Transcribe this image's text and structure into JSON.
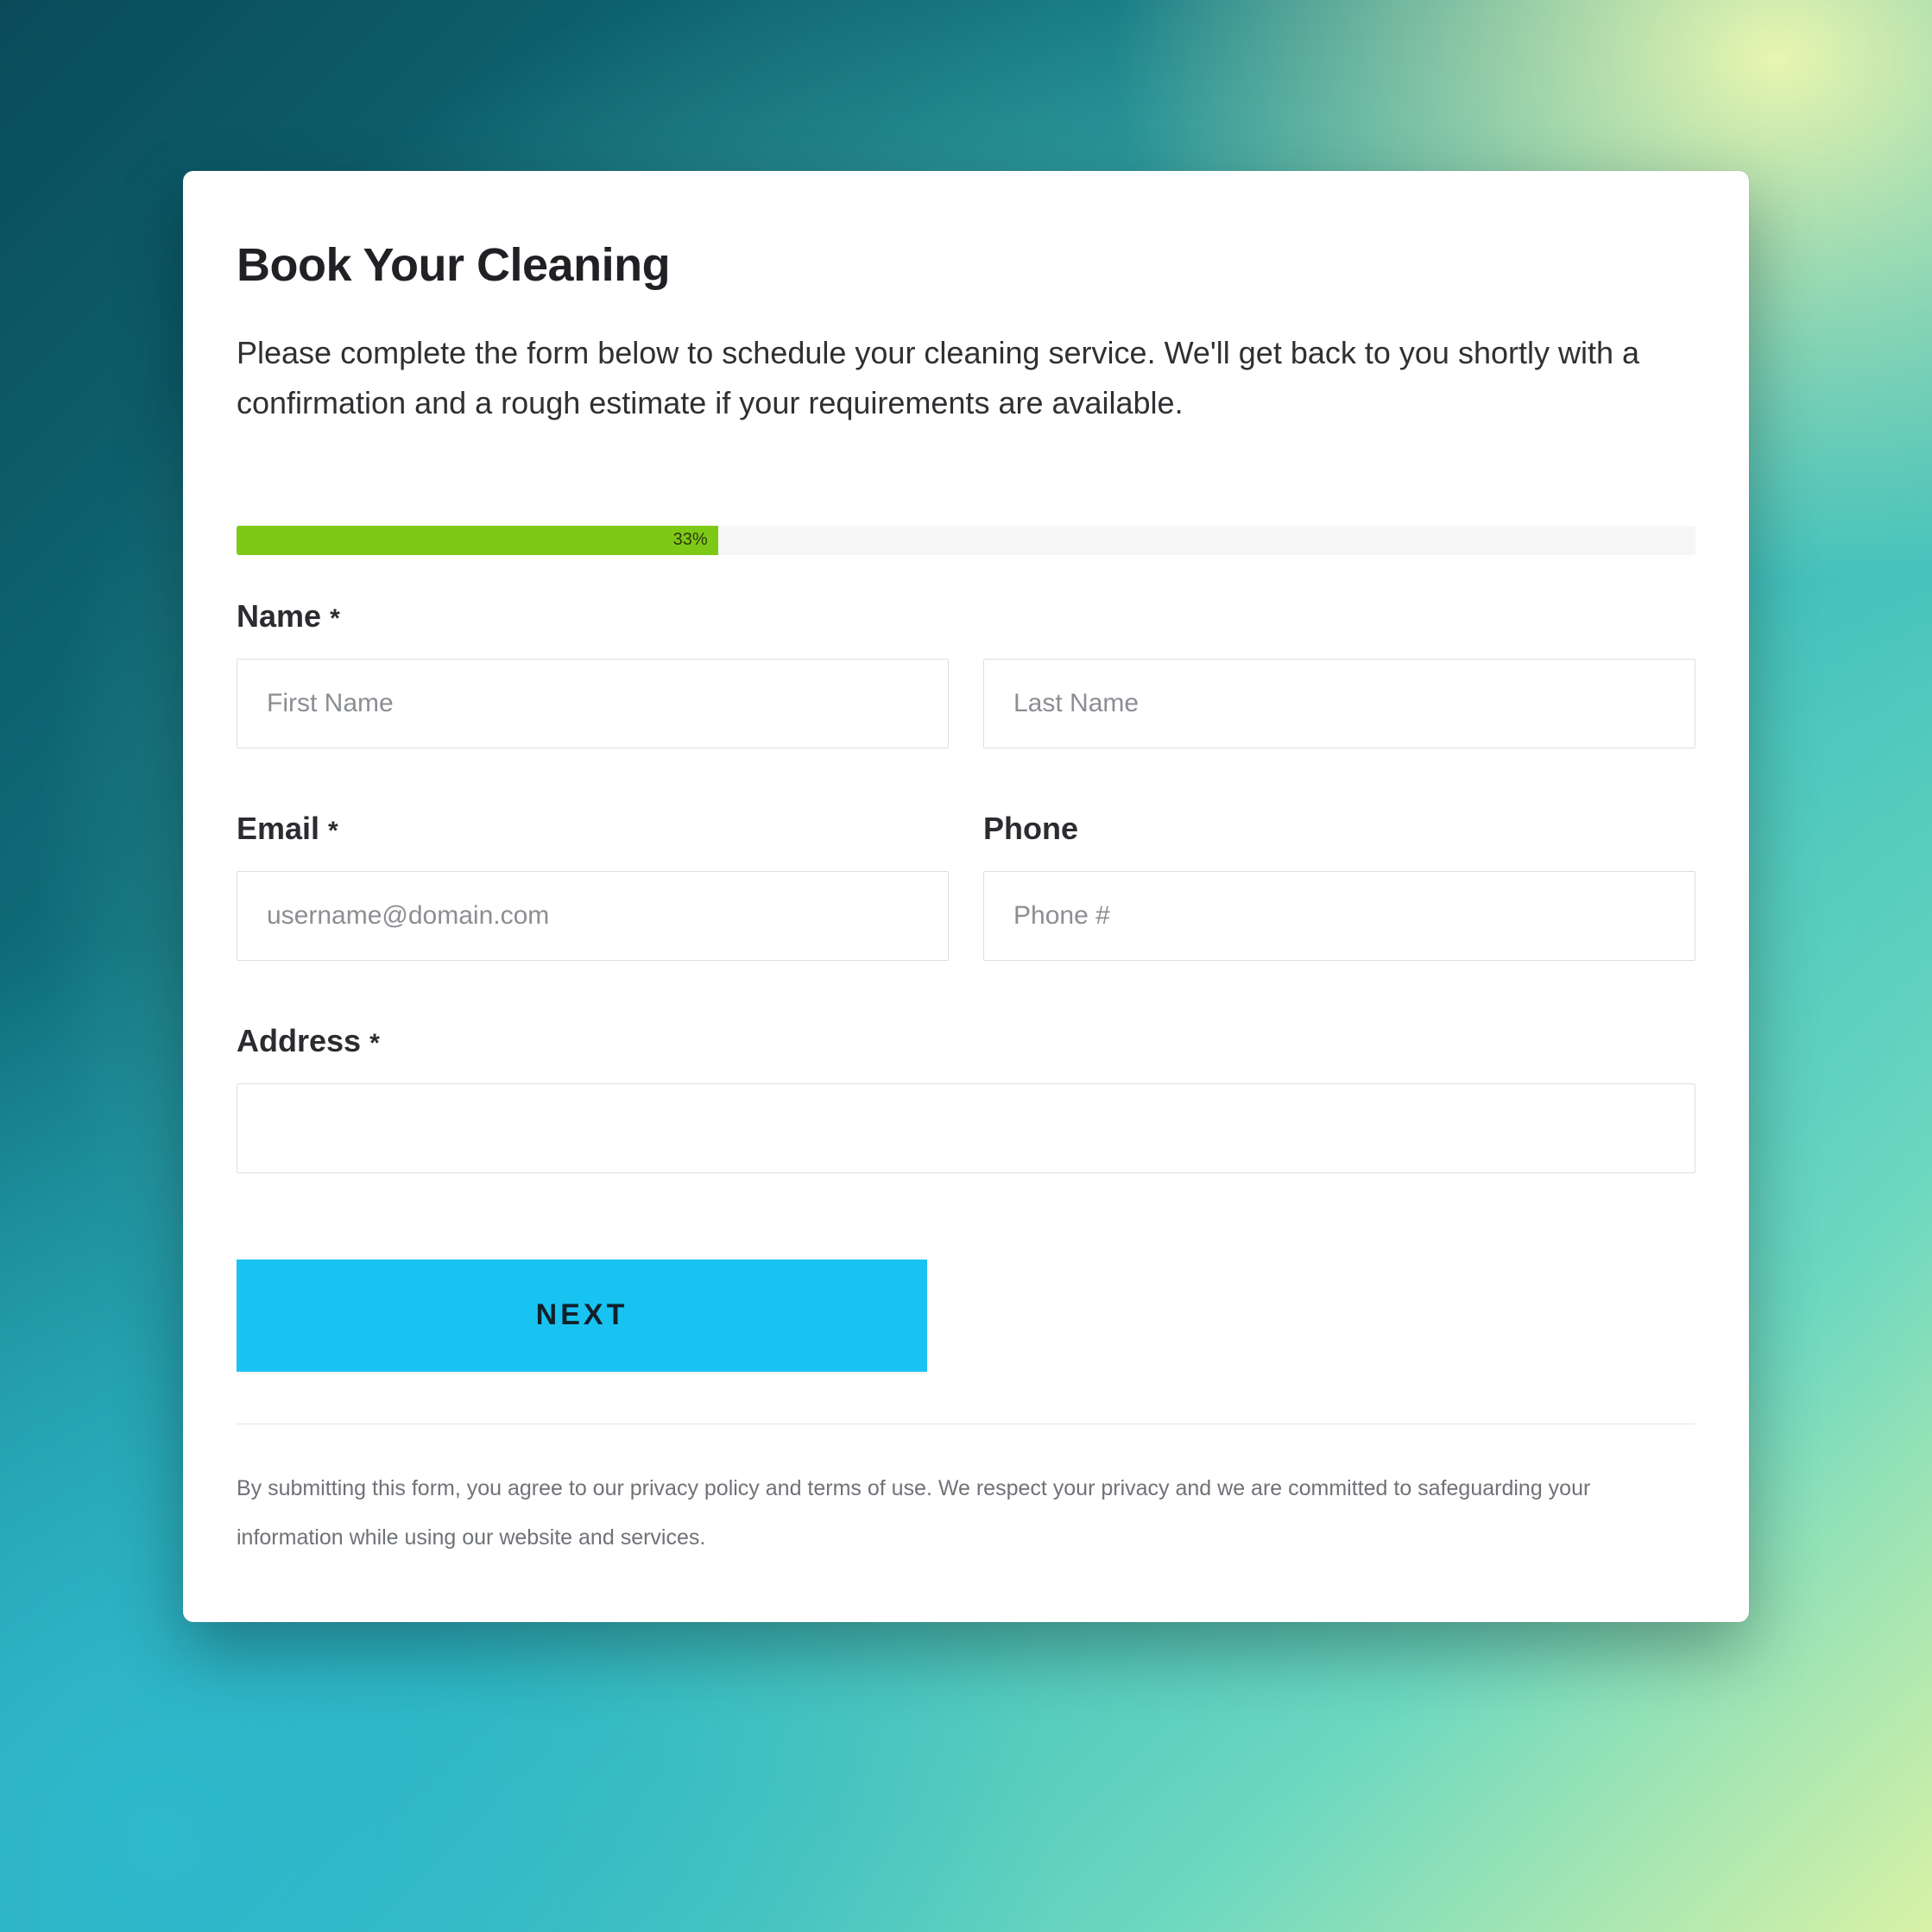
{
  "title": "Book Your Cleaning",
  "subtitle": "Please complete the form below to schedule your cleaning service. We'll get back to you shortly with a confirmation and a rough estimate if your requirements are available.",
  "progress": {
    "percent": 33,
    "label": "33%"
  },
  "labels": {
    "name": "Name",
    "email": "Email",
    "phone": "Phone",
    "address": "Address",
    "required": "*"
  },
  "placeholders": {
    "first_name": "First Name",
    "last_name": "Last Name",
    "email": "username@domain.com",
    "phone": "Phone #",
    "address": ""
  },
  "values": {
    "first_name": "",
    "last_name": "",
    "email": "",
    "phone": "",
    "address": ""
  },
  "button": {
    "next": "NEXT"
  },
  "disclaimer": "By submitting this form, you agree to our privacy policy and terms of use. We respect your privacy and we are committed to safeguarding your information while using our website and services.",
  "colors": {
    "progress_fill": "#7ec916",
    "button_bg": "#18c3f2"
  }
}
